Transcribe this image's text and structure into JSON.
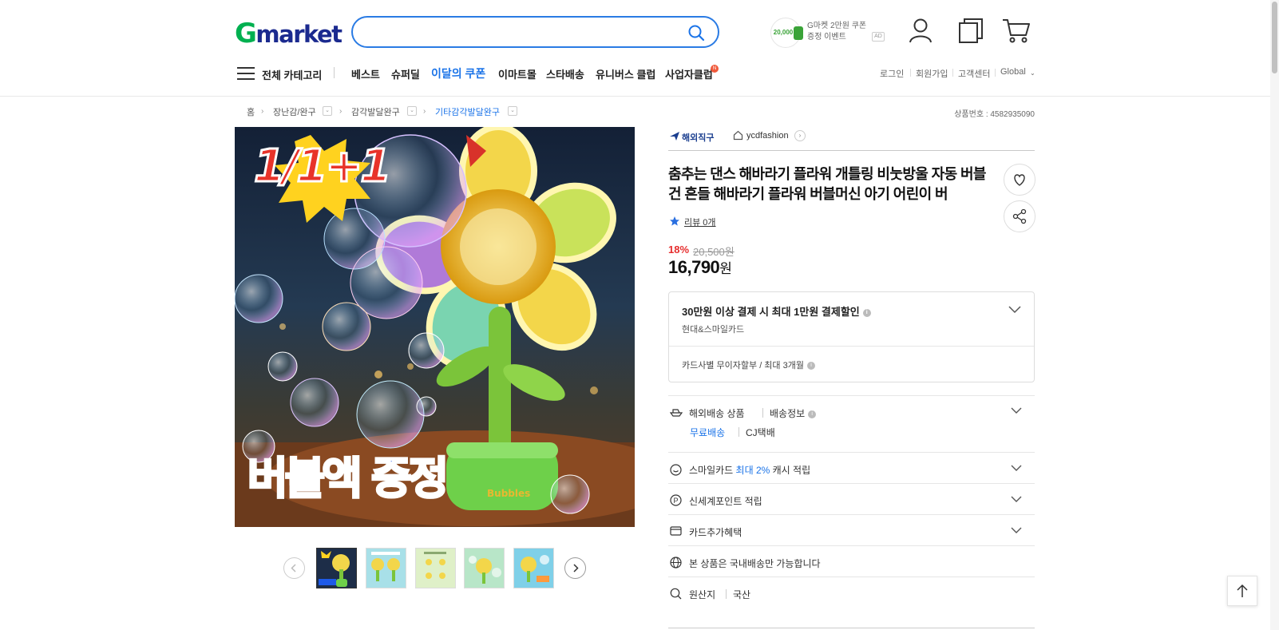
{
  "header": {
    "logo_g": "G",
    "logo_rest": "market",
    "search_placeholder": "",
    "coupon_amount": "20,000",
    "coupon_line1": "G마켓 2만원 쿠폰",
    "coupon_line2": "증정 이벤트",
    "ad_label": "AD",
    "icons": [
      "search-icon",
      "user-icon",
      "recent-icon",
      "cart-icon"
    ]
  },
  "nav": {
    "all_categories": "전체 카테고리",
    "items": [
      "베스트",
      "슈퍼딜",
      "이달의 쿠폰",
      "이마트몰",
      "스타배송",
      "유니버스 클럽",
      "사업자클럽"
    ],
    "new_badge": "N",
    "util": [
      "로그인",
      "회원가입",
      "고객센터",
      "Global"
    ]
  },
  "breadcrumb": {
    "items": [
      "홈",
      "장난감/완구",
      "감각발달완구",
      "기타감각발달완구"
    ],
    "product_no": "상품번호 : 4582935090"
  },
  "image": {
    "promo_top": "1/1+1",
    "promo_bottom": "버블액 증정",
    "toy_label": "Bubbles",
    "thumb_count": 5
  },
  "product": {
    "overseas_tag": "해외직구",
    "store_name": "ycdfashion",
    "title": "춤추는 댄스 해바라기 플라워 개틀링 비눗방울 자동 버블건 흔들 해바라기 플라워 버블머신 아기 어린이 버",
    "review_label": "리뷰 0개",
    "discount_rate": "18%",
    "original_price": "20,500원",
    "price": "16,790",
    "price_unit": "원"
  },
  "card_benefit": {
    "main": "30만원 이상 결제 시 최대 1만원 결제할인",
    "sub": "현대&스마일카드",
    "installment": "카드사별 무이자할부 / 최대 3개월"
  },
  "info_rows": {
    "shipping_type": "해외배송 상품",
    "shipping_info": "배송정보",
    "free_shipping": "무료배송",
    "courier": "CJ택배",
    "smilecard_pre": "스마일카드 ",
    "smilecard_hl": "최대 2%",
    "smilecard_post": " 캐시 적립",
    "shinsegae": "신세계포인트 적립",
    "card_extra": "카드추가혜택",
    "domestic_only": "본 상품은 국내배송만 가능합니다",
    "origin_label": "원산지",
    "origin_value": "국산"
  },
  "colors": {
    "brand_green": "#00b050",
    "brand_blue": "#1b2a8f",
    "accent_blue": "#1a73e8",
    "discount_red": "#e62e2e"
  }
}
